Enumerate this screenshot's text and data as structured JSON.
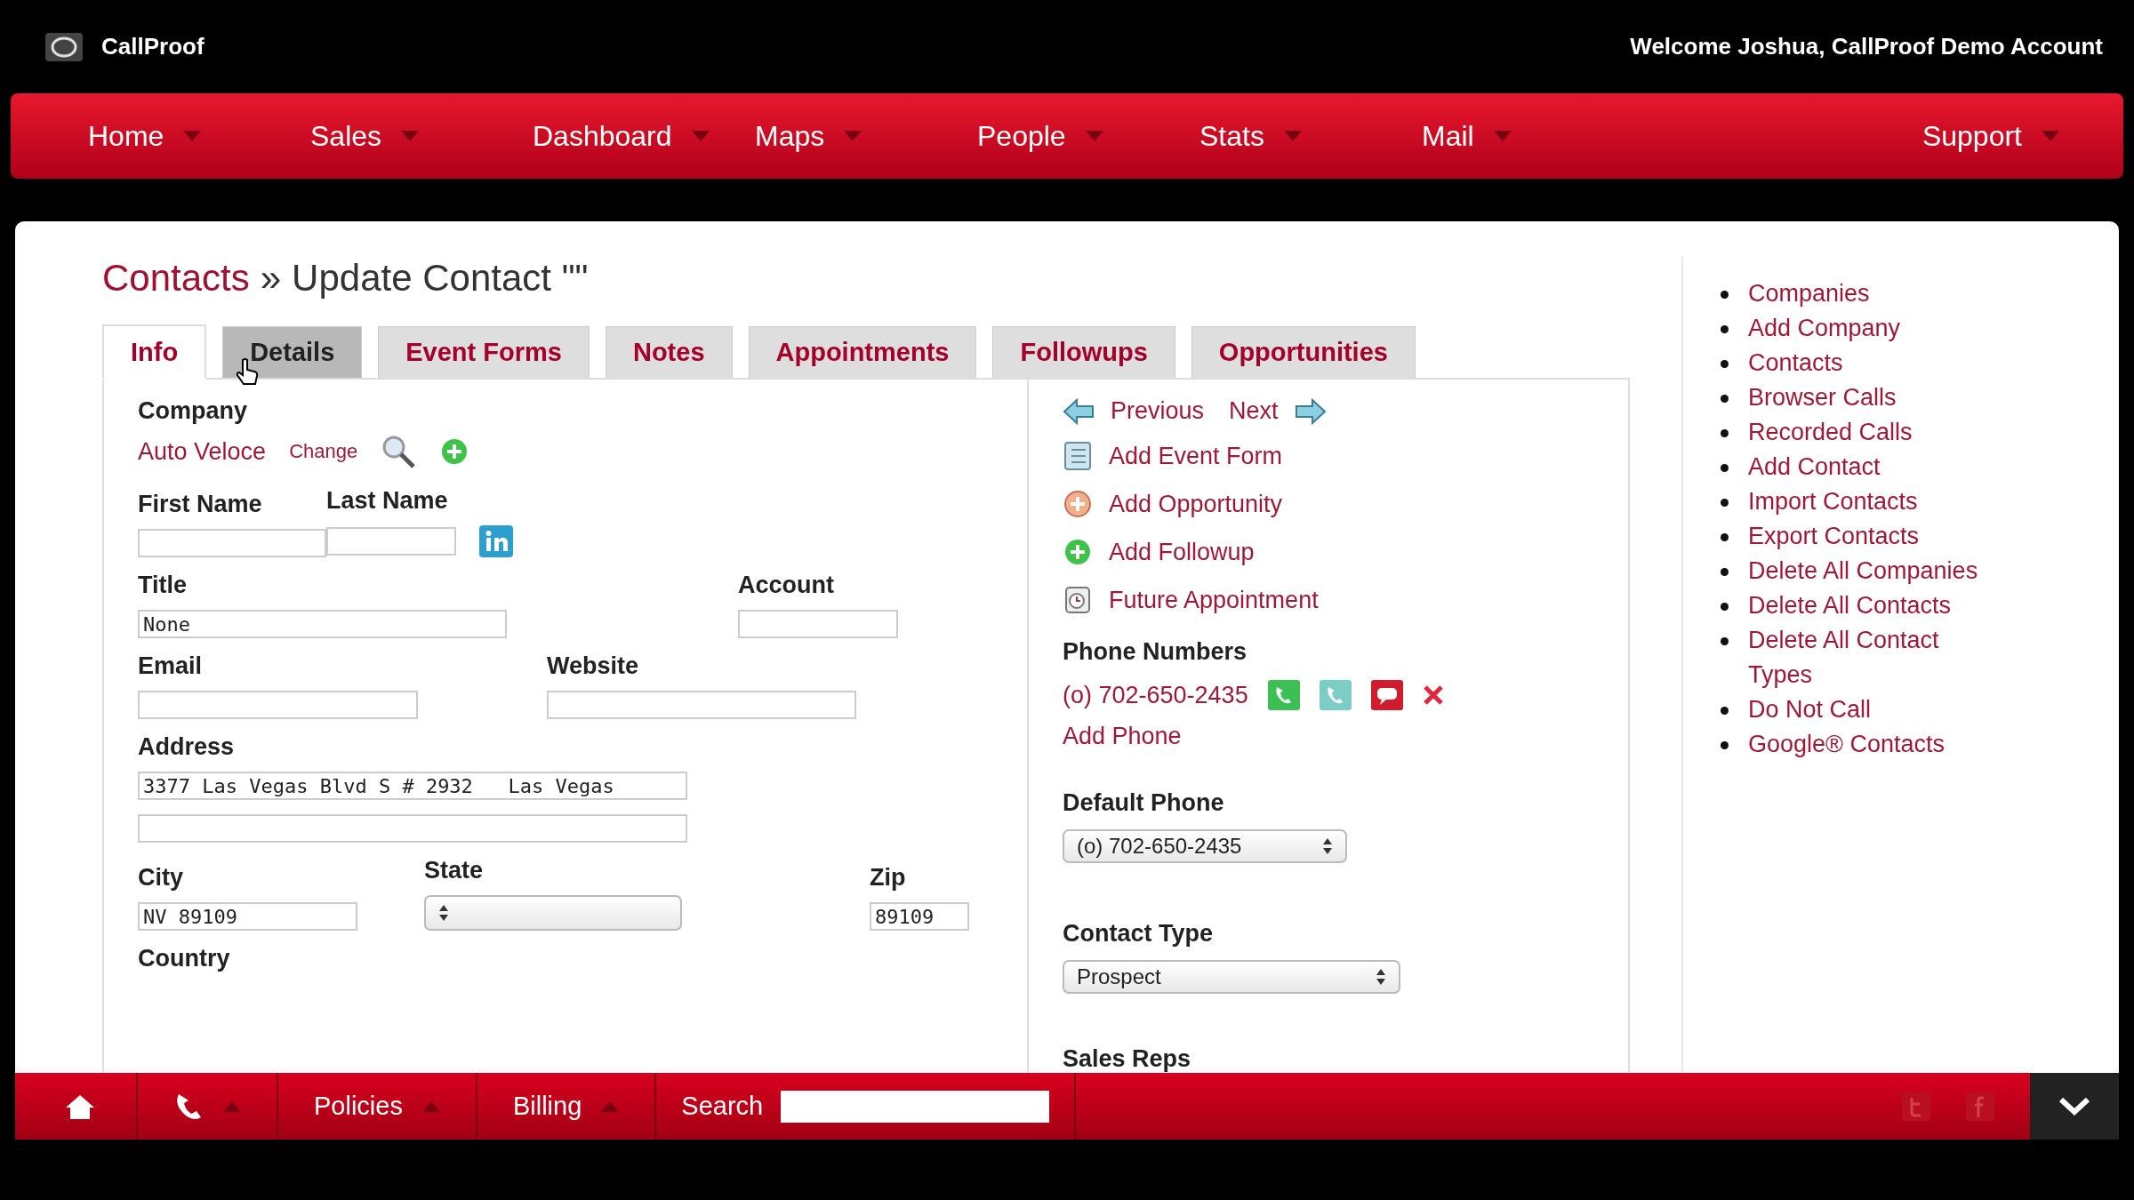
{
  "header": {
    "app_name": "CallProof",
    "welcome": "Welcome Joshua, CallProof Demo Account"
  },
  "nav": [
    {
      "label": "Home"
    },
    {
      "label": "Sales"
    },
    {
      "label": "Dashboard"
    },
    {
      "label": "Maps"
    },
    {
      "label": "People"
    },
    {
      "label": "Stats"
    },
    {
      "label": "Mail"
    },
    {
      "label": "Support"
    }
  ],
  "breadcrumb": {
    "parent": "Contacts",
    "separator": "»",
    "current": "Update Contact \"\""
  },
  "tabs": [
    {
      "label": "Info",
      "selected": true,
      "hovered": false
    },
    {
      "label": "Details",
      "selected": false,
      "hovered": true
    },
    {
      "label": "Event Forms",
      "selected": false,
      "hovered": false
    },
    {
      "label": "Notes",
      "selected": false,
      "hovered": false
    },
    {
      "label": "Appointments",
      "selected": false,
      "hovered": false
    },
    {
      "label": "Followups",
      "selected": false,
      "hovered": false
    },
    {
      "label": "Opportunities",
      "selected": false,
      "hovered": false
    }
  ],
  "company": {
    "label": "Company",
    "value": "Auto Veloce",
    "change": "Change"
  },
  "form_rows": [
    [
      {
        "label": "First Name",
        "kind": "input"
      },
      {
        "label": "Last Name",
        "kind": "input"
      }
    ],
    [
      {
        "label": "Title",
        "kind": "input",
        "value": "None"
      },
      {
        "label": "Account",
        "kind": "input"
      }
    ],
    [
      {
        "label": "Email",
        "kind": "input"
      },
      {
        "label": "Website",
        "kind": "input"
      }
    ],
    [
      {
        "label": "Address",
        "kind": "input",
        "value": "3377 Las Vegas Blvd S # 2932   Las Vegas"
      }
    ],
    [
      {
        "kind": "input"
      }
    ],
    [
      {
        "label": "City",
        "kind": "input",
        "value": "NV 89109"
      },
      {
        "label": "State",
        "kind": "select"
      },
      {
        "label": "Zip",
        "kind": "input",
        "value": "89109"
      }
    ],
    [
      {
        "label": "Country",
        "kind": "label"
      }
    ]
  ],
  "nav_links": {
    "previous": "Previous",
    "next": "Next"
  },
  "actions": [
    {
      "label": "Add Event Form"
    },
    {
      "label": "Add Opportunity"
    },
    {
      "label": "Add Followup"
    },
    {
      "label": "Future Appointment"
    }
  ],
  "phones": {
    "label": "Phone Numbers",
    "items": [
      {
        "number": "(o) 702-650-2435"
      }
    ],
    "add": "Add Phone"
  },
  "default_phone": {
    "label": "Default Phone",
    "value": "(o) 702-650-2435"
  },
  "contact_type": {
    "label": "Contact Type",
    "value": "Prospect"
  },
  "sales_reps": {
    "label": "Sales Reps"
  },
  "sidebar": [
    "Companies",
    "Add Company",
    "Contacts",
    "Browser Calls",
    "Recorded Calls",
    "Add Contact",
    "Import Contacts",
    "Export Contacts",
    "Delete All Companies",
    "Delete All Contacts",
    "Delete All Contact Types",
    "Do Not Call",
    "Google® Contacts"
  ],
  "footer": {
    "menus": [
      {
        "label": "Policies"
      },
      {
        "label": "Billing"
      }
    ],
    "search_label": "Search"
  }
}
